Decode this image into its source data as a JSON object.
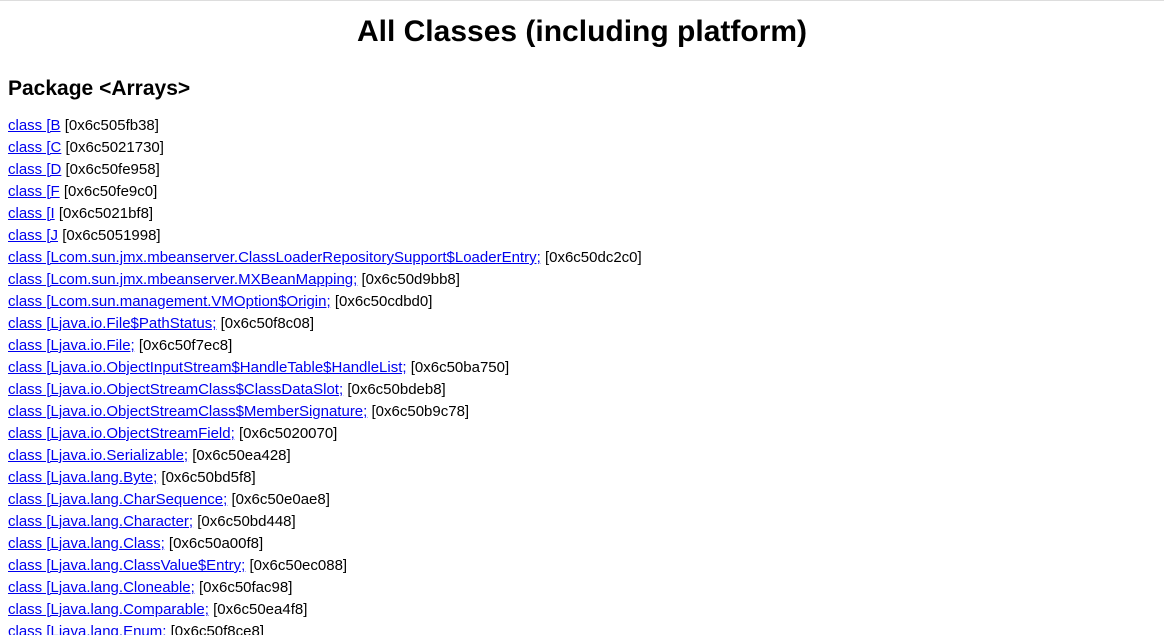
{
  "title": "All Classes (including platform)",
  "package_heading": "Package <Arrays>",
  "entries": [
    {
      "link": "class [B",
      "addr": "[0x6c505fb38]"
    },
    {
      "link": "class [C",
      "addr": "[0x6c5021730]"
    },
    {
      "link": "class [D",
      "addr": "[0x6c50fe958]"
    },
    {
      "link": "class [F",
      "addr": "[0x6c50fe9c0]"
    },
    {
      "link": "class [I",
      "addr": "[0x6c5021bf8]"
    },
    {
      "link": "class [J",
      "addr": "[0x6c5051998]"
    },
    {
      "link": "class [Lcom.sun.jmx.mbeanserver.ClassLoaderRepositorySupport$LoaderEntry;",
      "addr": "[0x6c50dc2c0]"
    },
    {
      "link": "class [Lcom.sun.jmx.mbeanserver.MXBeanMapping;",
      "addr": "[0x6c50d9bb8]"
    },
    {
      "link": "class [Lcom.sun.management.VMOption$Origin;",
      "addr": "[0x6c50cdbd0]"
    },
    {
      "link": "class [Ljava.io.File$PathStatus;",
      "addr": "[0x6c50f8c08]"
    },
    {
      "link": "class [Ljava.io.File;",
      "addr": "[0x6c50f7ec8]"
    },
    {
      "link": "class [Ljava.io.ObjectInputStream$HandleTable$HandleList;",
      "addr": "[0x6c50ba750]"
    },
    {
      "link": "class [Ljava.io.ObjectStreamClass$ClassDataSlot;",
      "addr": "[0x6c50bdeb8]"
    },
    {
      "link": "class [Ljava.io.ObjectStreamClass$MemberSignature;",
      "addr": "[0x6c50b9c78]"
    },
    {
      "link": "class [Ljava.io.ObjectStreamField;",
      "addr": "[0x6c5020070]"
    },
    {
      "link": "class [Ljava.io.Serializable;",
      "addr": "[0x6c50ea428]"
    },
    {
      "link": "class [Ljava.lang.Byte;",
      "addr": "[0x6c50bd5f8]"
    },
    {
      "link": "class [Ljava.lang.CharSequence;",
      "addr": "[0x6c50e0ae8]"
    },
    {
      "link": "class [Ljava.lang.Character;",
      "addr": "[0x6c50bd448]"
    },
    {
      "link": "class [Ljava.lang.Class;",
      "addr": "[0x6c50a00f8]"
    },
    {
      "link": "class [Ljava.lang.ClassValue$Entry;",
      "addr": "[0x6c50ec088]"
    },
    {
      "link": "class [Ljava.lang.Cloneable;",
      "addr": "[0x6c50fac98]"
    },
    {
      "link": "class [Ljava.lang.Comparable;",
      "addr": "[0x6c50ea4f8]"
    },
    {
      "link": "class [Ljava.lang.Enum;",
      "addr": "[0x6c50f8ce8]"
    }
  ]
}
